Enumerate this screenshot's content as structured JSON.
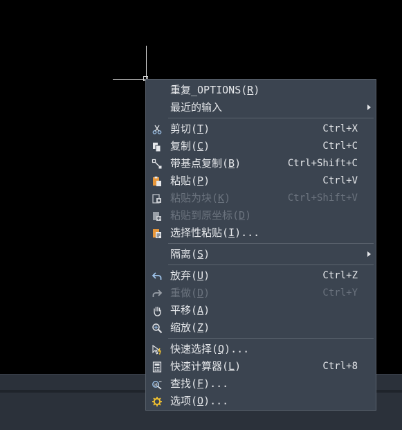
{
  "menu": {
    "items": [
      {
        "label": "重复_OPTIONS",
        "key": "R",
        "after": "",
        "shortcut": "",
        "icon": "none",
        "disabled": false,
        "submenu": false
      },
      {
        "label": "最近的输入",
        "key": "",
        "after": "",
        "shortcut": "",
        "icon": "none",
        "disabled": false,
        "submenu": true
      },
      {
        "label": "剪切",
        "key": "T",
        "after": "",
        "shortcut": "Ctrl+X",
        "icon": "scissors-icon",
        "disabled": false,
        "submenu": false
      },
      {
        "label": "复制",
        "key": "C",
        "after": "",
        "shortcut": "Ctrl+C",
        "icon": "copy-icon",
        "disabled": false,
        "submenu": false
      },
      {
        "label": "带基点复制",
        "key": "B",
        "after": "",
        "shortcut": "Ctrl+Shift+C",
        "icon": "copy-base-point-icon",
        "disabled": false,
        "submenu": false
      },
      {
        "label": "粘贴",
        "key": "P",
        "after": "",
        "shortcut": "Ctrl+V",
        "icon": "paste-icon",
        "disabled": false,
        "submenu": false
      },
      {
        "label": "粘贴为块",
        "key": "K",
        "after": "",
        "shortcut": "Ctrl+Shift+V",
        "icon": "paste-as-block-icon",
        "disabled": true,
        "submenu": false
      },
      {
        "label": "粘贴到原坐标",
        "key": "D",
        "after": "",
        "shortcut": "",
        "icon": "paste-original-coords-icon",
        "disabled": true,
        "submenu": false
      },
      {
        "label": "选择性粘贴",
        "key": "I",
        "after": "...",
        "shortcut": "",
        "icon": "paste-special-icon",
        "disabled": false,
        "submenu": false
      },
      {
        "label": "隔离",
        "key": "S",
        "after": "",
        "shortcut": "",
        "icon": "none",
        "disabled": false,
        "submenu": true
      },
      {
        "label": "放弃",
        "key": "U",
        "after": "",
        "shortcut": "Ctrl+Z",
        "icon": "undo-icon",
        "disabled": false,
        "submenu": false
      },
      {
        "label": "重做",
        "key": "D",
        "after": "",
        "shortcut": "Ctrl+Y",
        "icon": "redo-icon",
        "disabled": true,
        "submenu": false
      },
      {
        "label": "平移",
        "key": "A",
        "after": "",
        "shortcut": "",
        "icon": "pan-hand-icon",
        "disabled": false,
        "submenu": false
      },
      {
        "label": "缩放",
        "key": "Z",
        "after": "",
        "shortcut": "",
        "icon": "zoom-icon",
        "disabled": false,
        "submenu": false
      },
      {
        "label": "快速选择",
        "key": "Q",
        "after": "...",
        "shortcut": "",
        "icon": "quick-select-icon",
        "disabled": false,
        "submenu": false
      },
      {
        "label": "快速计算器",
        "key": "L",
        "after": "",
        "shortcut": "Ctrl+8",
        "icon": "calculator-icon",
        "disabled": false,
        "submenu": false
      },
      {
        "label": "查找",
        "key": "F",
        "after": "...",
        "shortcut": "",
        "icon": "find-icon",
        "disabled": false,
        "submenu": false
      },
      {
        "label": "选项",
        "key": "O",
        "after": "...",
        "shortcut": "",
        "icon": "options-gear-icon",
        "disabled": false,
        "submenu": false
      }
    ]
  },
  "colors": {
    "menu_bg": "#3b4450",
    "text": "#e6e8eb",
    "disabled_text": "#6b737e",
    "canvas": "#000000",
    "statusbar": "#2b313a"
  }
}
